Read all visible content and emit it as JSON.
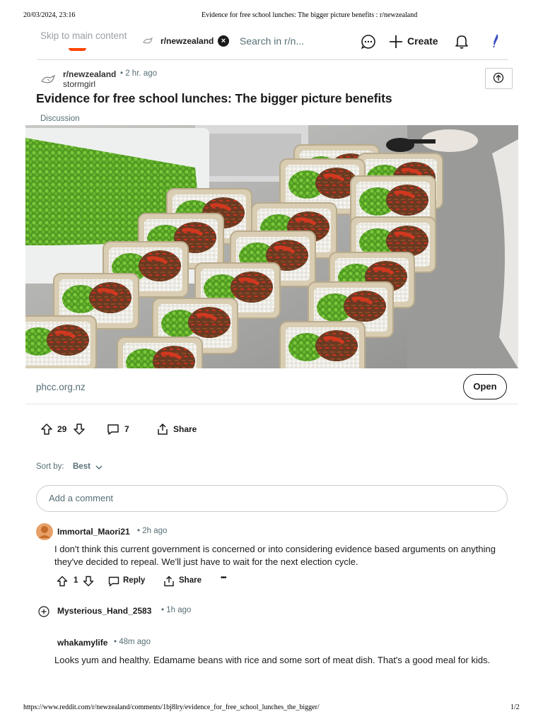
{
  "print": {
    "date": "20/03/2024, 23:16",
    "doc_title": "Evidence for free school lunches: The bigger picture benefits : r/newzealand",
    "url": "https://www.reddit.com/r/newzealand/comments/1bj8lry/evidence_for_free_school_lunches_the_bigger/",
    "page": "1/2"
  },
  "header": {
    "skip_link": "Skip to main content",
    "subreddit_chip": "r/newzealand",
    "search_placeholder": "Search in r/n...",
    "create_label": "Create",
    "brand_color": "#ff4500"
  },
  "post": {
    "subreddit": "r/newzealand",
    "age": "• 2 hr. ago",
    "author": "stormgirl",
    "title": "Evidence for free school lunches: The bigger picture benefits",
    "flair": "Discussion",
    "link_domain": "phcc.org.nz",
    "open_label": "Open",
    "score": "29",
    "comment_count": "7",
    "share_label": "Share"
  },
  "sort": {
    "label": "Sort by:",
    "value": "Best"
  },
  "comment_box": {
    "placeholder": "Add a comment"
  },
  "comments": [
    {
      "user": "Immortal_Maori21",
      "age": "• 2h ago",
      "body": "I don't think this current government is concerned or into considering evidence based arguments on anything they've decided to repeal. We'll just have to wait for the next election cycle.",
      "score": "1",
      "reply_label": "Reply",
      "share_label": "Share",
      "more_label": "•••"
    },
    {
      "user": "Mysterious_Hand_2583",
      "age": "• 1h ago"
    },
    {
      "user": "whakamylife",
      "age": "• 48m ago",
      "body": "Looks yum and healthy. Edamame beans with rice and some sort of meat dish. That's a good meal for kids."
    }
  ]
}
